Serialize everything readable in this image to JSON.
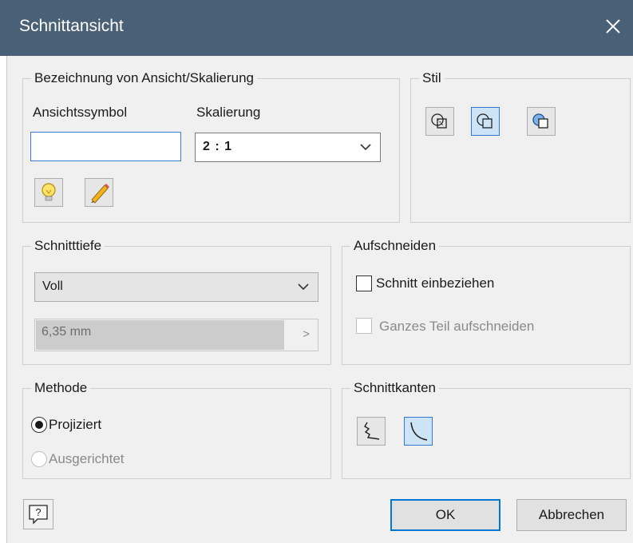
{
  "window": {
    "title": "Schnittansicht"
  },
  "view_label": {
    "group_title": "Bezeichnung von Ansicht/Skalierung",
    "symbol_label": "Ansichtssymbol",
    "symbol_value": "",
    "scale_label": "Skalierung",
    "scale_value": "2 : 1"
  },
  "style": {
    "group_title": "Stil"
  },
  "depth": {
    "group_title": "Schnitttiefe",
    "mode_value": "Voll",
    "distance_value": "6,35 mm"
  },
  "cut": {
    "group_title": "Aufschneiden",
    "include_label": "Schnitt einbeziehen",
    "full_part_label": "Ganzes Teil aufschneiden"
  },
  "method": {
    "group_title": "Methode",
    "projected_label": "Projiziert",
    "aligned_label": "Ausgerichtet"
  },
  "edges": {
    "group_title": "Schnittkanten"
  },
  "buttons": {
    "ok": "OK",
    "cancel": "Abbrechen",
    "help_icon": "help-icon"
  },
  "colors": {
    "titlebar": "#4a6077",
    "dialog_bg": "#f0f0f0",
    "accent": "#0078d7"
  }
}
